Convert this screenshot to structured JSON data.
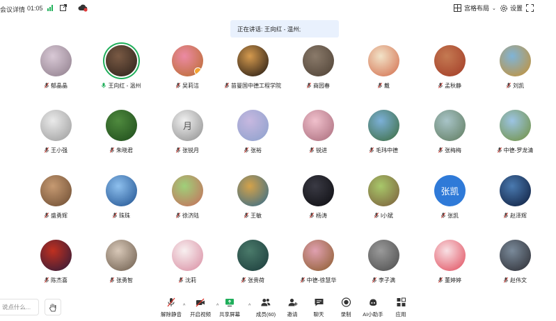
{
  "topbar": {
    "meeting_info": "会议详情",
    "timer": "01:05",
    "layout_label": "宫格布局",
    "settings_label": "设置"
  },
  "speaking_banner": "正在讲话: 王向红 - 温州;",
  "participants": [
    {
      "name": "郁晶晶",
      "bg": [
        "#d9c9d6",
        "#8d7c8a"
      ],
      "muted": true
    },
    {
      "name": "王向红 - 温州",
      "bg": [
        "#7a5a44",
        "#2b201a"
      ],
      "muted": false,
      "speaking": true
    },
    {
      "name": "吴莉洁",
      "bg": [
        "#ec8aa4",
        "#b86a2a"
      ],
      "muted": true,
      "badge": true
    },
    {
      "name": "苗曼国中德工程学院",
      "bg": [
        "#d59a4e",
        "#1c1410"
      ],
      "muted": true
    },
    {
      "name": "商园春",
      "bg": [
        "#8a7a6a",
        "#4d4034"
      ],
      "muted": true
    },
    {
      "name": "戴",
      "bg": [
        "#f2e3c8",
        "#d26b4a"
      ],
      "muted": true
    },
    {
      "name": "孟秋静",
      "bg": [
        "#c47a52",
        "#a23a26"
      ],
      "muted": true
    },
    {
      "name": "刘凯",
      "bg": [
        "#7fb4d8",
        "#c98f2c"
      ],
      "muted": true
    },
    {
      "name": "王小强",
      "bg": [
        "#eaeaea",
        "#9a9a9a"
      ],
      "muted": true
    },
    {
      "name": "朱晓君",
      "bg": [
        "#4f8a3e",
        "#1d4a1a"
      ],
      "muted": true
    },
    {
      "name": "张锐月",
      "bg": [
        "#f0f0f0",
        "#8c8c8c"
      ],
      "muted": true,
      "text": "月",
      "text_color": "#555"
    },
    {
      "name": "张裕",
      "bg": [
        "#c7b8e0",
        "#8aa0cc"
      ],
      "muted": true
    },
    {
      "name": "锐进",
      "bg": [
        "#f0c0cc",
        "#a86a7a"
      ],
      "muted": true
    },
    {
      "name": "毛玮中德",
      "bg": [
        "#7cb0d8",
        "#3a6a3a"
      ],
      "muted": true
    },
    {
      "name": "张梅梅",
      "bg": [
        "#a8c4c8",
        "#5e7a5c"
      ],
      "muted": true
    },
    {
      "name": "中德-罗龙清",
      "bg": [
        "#9cc4e4",
        "#6f8f3a"
      ],
      "muted": true
    },
    {
      "name": "盛勇辉",
      "bg": [
        "#c69a72",
        "#6a4a30"
      ],
      "muted": true
    },
    {
      "name": "珠珠",
      "bg": [
        "#8ec0ee",
        "#1d4f8e"
      ],
      "muted": true
    },
    {
      "name": "徐济陆",
      "bg": [
        "#9fd07a",
        "#c86a5a"
      ],
      "muted": true
    },
    {
      "name": "王敏",
      "bg": [
        "#d4a24a",
        "#2f6a8c"
      ],
      "muted": true
    },
    {
      "name": "杨涛",
      "bg": [
        "#3a3a44",
        "#0c0c10"
      ],
      "muted": true
    },
    {
      "name": "l小斌",
      "bg": [
        "#a8c86a",
        "#7a5a3a"
      ],
      "muted": true
    },
    {
      "name": "张凯",
      "bg": [
        "#2f7ad8",
        "#2f7ad8"
      ],
      "muted": true,
      "text": "张凯",
      "text_color": "#ffffff"
    },
    {
      "name": "赵泽辉",
      "bg": [
        "#4a7ab0",
        "#0c1a3a"
      ],
      "muted": true
    },
    {
      "name": "陈杰喜",
      "bg": [
        "#c03020",
        "#2a1a3a"
      ],
      "muted": true
    },
    {
      "name": "张勇智",
      "bg": [
        "#d8c8b8",
        "#6a5a4a"
      ],
      "muted": true
    },
    {
      "name": "沈莉",
      "bg": [
        "#f8f0f0",
        "#d88aa0"
      ],
      "muted": true
    },
    {
      "name": "张贵荷",
      "bg": [
        "#4a7a6a",
        "#1a3a3a"
      ],
      "muted": true
    },
    {
      "name": "中德-徐慧华",
      "bg": [
        "#e0a0b0",
        "#8a5a2a"
      ],
      "muted": true
    },
    {
      "name": "李子满",
      "bg": [
        "#9a9a9a",
        "#4a4a4a"
      ],
      "muted": true
    },
    {
      "name": "董婷婷",
      "bg": [
        "#f8e0e4",
        "#e04a5a"
      ],
      "muted": true
    },
    {
      "name": "赵伟文",
      "bg": [
        "#7a8a9a",
        "#2a2a30"
      ],
      "muted": true
    }
  ],
  "bottombar": {
    "chat_placeholder": "说点什么...",
    "tools": [
      {
        "label": "解除静音",
        "icon": "mic-off-icon"
      },
      {
        "label": "开启视频",
        "icon": "video-off-icon"
      },
      {
        "label": "共享屏幕",
        "icon": "share-screen-icon"
      },
      {
        "label": "成员(60)",
        "icon": "members-icon"
      },
      {
        "label": "邀请",
        "icon": "invite-icon"
      },
      {
        "label": "聊天",
        "icon": "chat-icon"
      },
      {
        "label": "录制",
        "icon": "record-icon"
      },
      {
        "label": "AI小助手",
        "icon": "ai-assistant-icon"
      },
      {
        "label": "应用",
        "icon": "apps-icon"
      }
    ]
  },
  "colors": {
    "accent_green": "#1fae5a",
    "muted_red": "#d9342b",
    "banner_bg": "#e9f1fd"
  }
}
